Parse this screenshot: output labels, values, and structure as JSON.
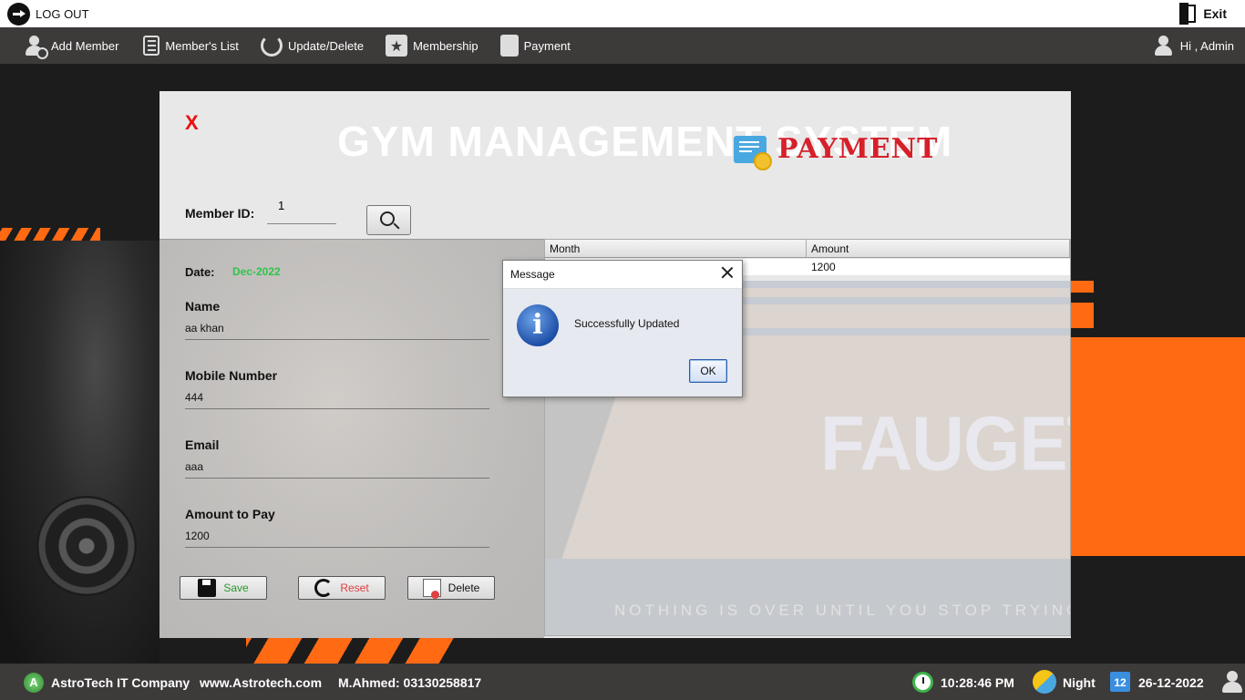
{
  "topbar": {
    "logout_label": "LOG OUT",
    "exit_label": "Exit"
  },
  "nav": {
    "items": [
      {
        "label": "Add Member",
        "icon": "add-user-icon"
      },
      {
        "label": "Member's List",
        "icon": "list-icon"
      },
      {
        "label": "Update/Delete",
        "icon": "refresh-icon"
      },
      {
        "label": "Membership",
        "icon": "star-icon"
      },
      {
        "label": "Payment",
        "icon": "payment-icon"
      }
    ],
    "greeting": "Hi , Admin"
  },
  "panel": {
    "close_label": "X",
    "title": "GYM MANAGEMENT SYSTEM",
    "payment_heading": "PAYMENT",
    "member_id_label": "Member ID:",
    "member_id_value": "1",
    "date_label": "Date:",
    "date_value": "Dec-2022",
    "fields": {
      "name_label": "Name",
      "name_value": "aa khan",
      "mobile_label": "Mobile Number",
      "mobile_value": "444",
      "email_label": "Email",
      "email_value": "aaa",
      "amount_label": "Amount to Pay",
      "amount_value": "1200"
    },
    "buttons": {
      "save": "Save",
      "reset": "Reset",
      "delete": "Delete"
    },
    "button_colors": {
      "save": "#2a9a2a",
      "reset": "#e04040",
      "delete": "#111111"
    }
  },
  "table": {
    "headers": [
      "Month",
      "Amount"
    ],
    "rows": [
      {
        "month": "",
        "amount": "1200"
      }
    ],
    "watermark": "FAUGET",
    "tagline": "NOTHING IS OVER UNTIL YOU STOP TRYING"
  },
  "dialog": {
    "title": "Message",
    "message": "Successfully Updated",
    "ok_label": "OK",
    "icon": "info-icon"
  },
  "statusbar": {
    "company": "AstroTech IT Company",
    "website": "www.Astrotech.com",
    "contact": "M.Ahmed: 03130258817",
    "time": "10:28:46 PM",
    "mode": "Night",
    "date": "26-12-2022",
    "calendar_day": "12"
  },
  "colors": {
    "accent_orange": "#ff6a13",
    "bar_dark": "#3d3a3a",
    "date_green": "#2fc44a",
    "close_red": "#e81010",
    "payment_red": "#d6202a"
  }
}
